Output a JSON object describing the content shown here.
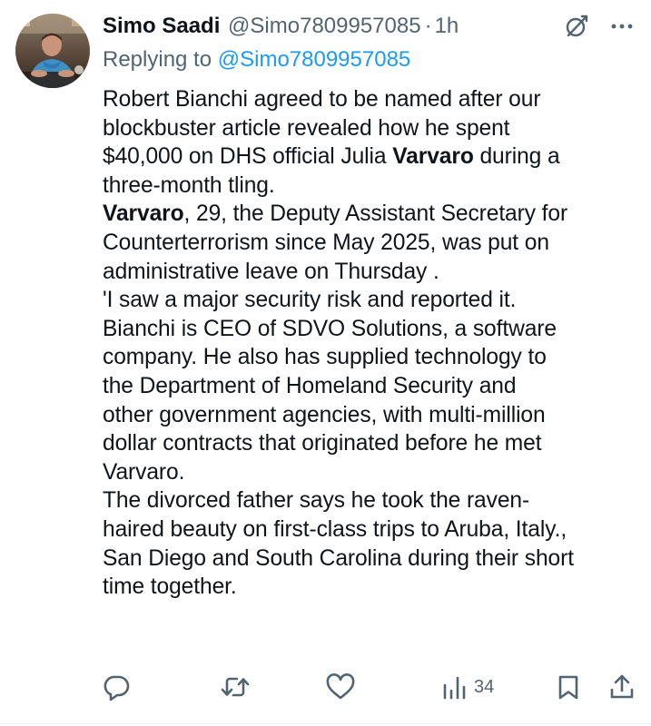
{
  "tweet": {
    "display_name": "Simo Saadi",
    "handle": "@Simo7809957085",
    "separator": "·",
    "time": "1h",
    "reply_prefix": "Replying to",
    "reply_to": "@Simo7809957085",
    "body_lines": [
      "Robert Bianchi agreed to be named after our",
      "blockbuster article revealed how he spent",
      "$40,000 on DHS official Julia",
      "Varvaro",
      "during a",
      "three-month tling.",
      "Varvaro",
      ", 29, the Deputy Assistant Secretary for",
      "Counterterrorism since May 2025, was put on",
      "administrative leave on Thursday .",
      "'I saw a major security risk and reported it.",
      "Bianchi is CEO of SDVO Solutions, a software",
      "company. He also has supplied technology to",
      "the Department of Homeland Security and",
      "other government agencies, with multi-million",
      "dollar contracts that originated before he met",
      "Varvaro.",
      "The divorced father says he took the raven-",
      "haired beauty on first-class trips to Aruba, Italy.,",
      "San Diego and South Carolina during their short",
      "time together."
    ]
  },
  "actions": {
    "views_count": "34"
  },
  "icons": {
    "grok": "grok-icon",
    "more": "more-dots-icon",
    "reply": "reply-bubble-icon",
    "retweet": "retweet-icon",
    "like": "heart-icon",
    "views": "views-bar-chart-icon",
    "bookmark": "bookmark-icon",
    "share": "share-upload-icon"
  },
  "colors": {
    "text_primary": "#0f1419",
    "text_secondary": "#536471",
    "link": "#1d9bf0",
    "divider": "#eff3f4"
  }
}
